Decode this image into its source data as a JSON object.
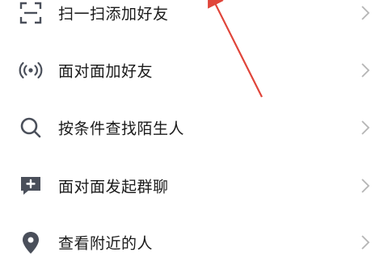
{
  "menu": {
    "items": [
      {
        "label": "扫一扫添加好友",
        "icon": "scan-icon"
      },
      {
        "label": "面对面加好友",
        "icon": "radar-icon"
      },
      {
        "label": "按条件查找陌生人",
        "icon": "search-icon"
      },
      {
        "label": "面对面发起群聊",
        "icon": "chat-plus-icon"
      },
      {
        "label": "查看附近的人",
        "icon": "location-pin-icon"
      }
    ]
  },
  "colors": {
    "icon": "#4a4f5a",
    "text": "#1a1a1a",
    "chevron": "#b5b5b5",
    "annotation": "#e0453a"
  }
}
